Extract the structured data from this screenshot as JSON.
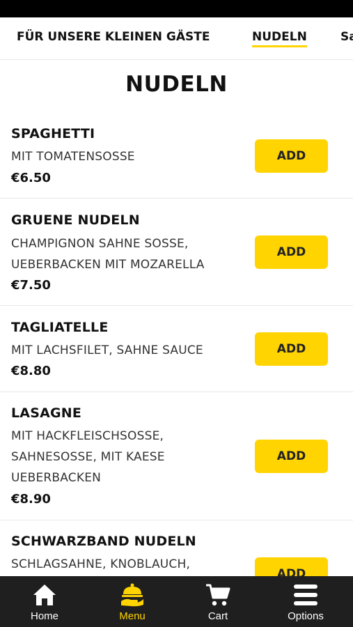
{
  "tabs": [
    {
      "label": "FÜR UNSERE KLEINEN GÄSTE",
      "active": false
    },
    {
      "label": "NUDELN",
      "active": true
    },
    {
      "label": "Sa",
      "active": false
    }
  ],
  "section": {
    "title": "NUDELN"
  },
  "items": [
    {
      "name": "SPAGHETTI",
      "desc_lines": [
        "MIT TOMATENSOSSE"
      ],
      "price": "€6.50",
      "add_label": "ADD"
    },
    {
      "name": "GRUENE NUDELN",
      "desc_lines": [
        "CHAMPIGNON SAHNE SOSSE,",
        "UEBERBACKEN MIT MOZARELLA"
      ],
      "price": "€7.50",
      "add_label": "ADD"
    },
    {
      "name": "TAGLIATELLE",
      "desc_lines": [
        "MIT LACHSFILET, SAHNE SAUCE"
      ],
      "price": "€8.80",
      "add_label": "ADD"
    },
    {
      "name": "LASAGNE",
      "desc_lines": [
        "MIT HACKFLEISCHSOSSE,",
        "SAHNESOSSE, MIT KAESE",
        "UEBERBACKEN"
      ],
      "price": "€8.90",
      "add_label": "ADD"
    },
    {
      "name": "SCHWARZBAND NUDELN",
      "desc_lines": [
        "SCHLAGSAHNE, KNOBLAUCH,"
      ],
      "price": "",
      "add_label": "ADD"
    }
  ],
  "nav": [
    {
      "label": "Home",
      "icon": "home-icon",
      "active": false
    },
    {
      "label": "Menu",
      "icon": "serving-dish-icon",
      "active": true
    },
    {
      "label": "Cart",
      "icon": "cart-icon",
      "active": false
    },
    {
      "label": "Options",
      "icon": "menu-bars-icon",
      "active": false
    }
  ],
  "colors": {
    "accent": "#ffd400",
    "nav_bg": "#1f1f1f",
    "status_bar": "#000000"
  }
}
